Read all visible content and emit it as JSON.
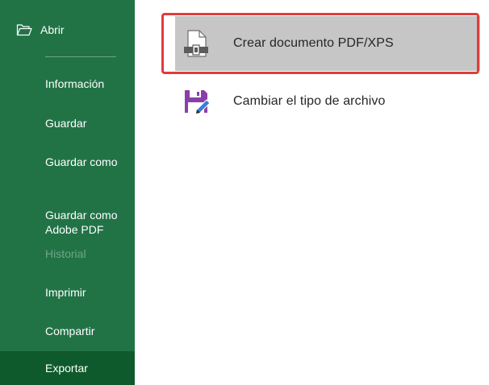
{
  "sidebar": {
    "open_label": "Abrir",
    "items": [
      {
        "label": "Información",
        "state": "normal"
      },
      {
        "label": "Guardar",
        "state": "normal"
      },
      {
        "label": "Guardar como",
        "state": "normal"
      },
      {
        "label": "Guardar como\nAdobe PDF",
        "state": "normal"
      },
      {
        "label": "Historial",
        "state": "disabled"
      },
      {
        "label": "Imprimir",
        "state": "normal"
      },
      {
        "label": "Compartir",
        "state": "normal"
      },
      {
        "label": "Exportar",
        "state": "active"
      }
    ],
    "icons": {
      "open": "folder-open-icon"
    }
  },
  "export": {
    "options": [
      {
        "label": "Crear documento PDF/XPS",
        "icon": "pdf-document-icon",
        "selected": true
      },
      {
        "label": "Cambiar el tipo de archivo",
        "icon": "change-file-type-icon",
        "selected": false
      }
    ]
  },
  "colors": {
    "sidebar_bg": "#217346",
    "sidebar_active": "#0f5a2c",
    "selected_option_bg": "#c6c6c6",
    "highlight_border": "#e03c3c",
    "purple_icon": "#8a3fa8"
  }
}
